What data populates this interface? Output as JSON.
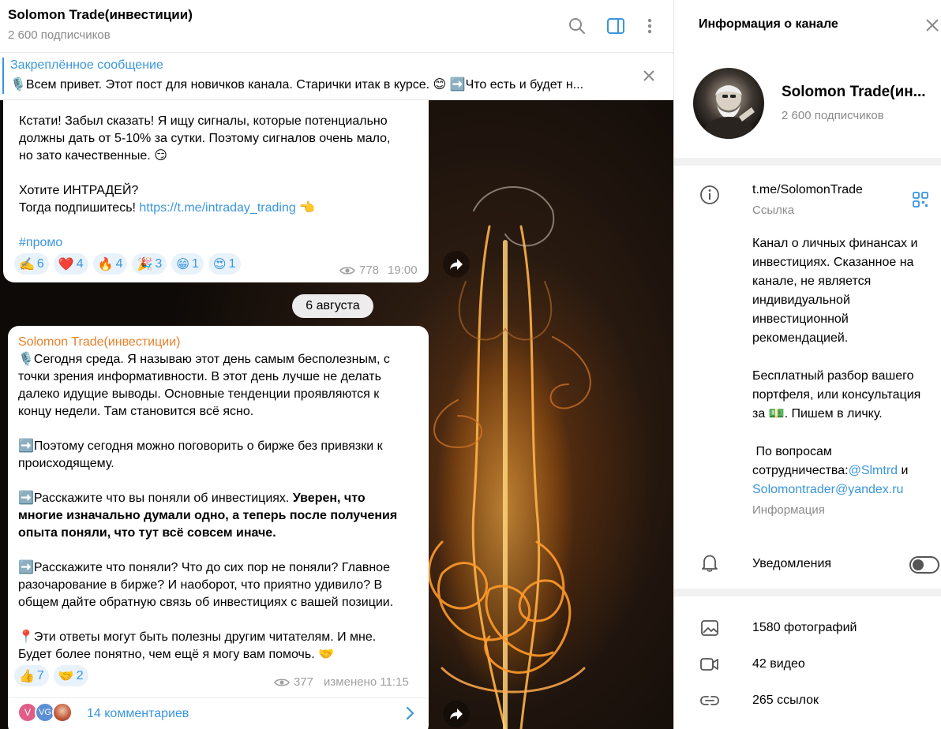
{
  "chat": {
    "title": "Solomon Trade(инвестиции)",
    "subscribers": "2 600 подписчиков",
    "pinned": {
      "title": "Закреплённое сообщение",
      "text": "🎙️Всем привет. Этот пост для новичков канала. Старички итак в курсе. 😊 ➡️Что есть и будет н..."
    },
    "message1": {
      "lines": [
        "Кстати! Забыл сказать! Я ищу сигналы, которые потенциально",
        "должны дать от 5-10% за сутки. Поэтому сигналов очень мало,",
        "но зато качественные. 😏",
        "",
        "Хотите ИНТРАДЕЙ?"
      ],
      "subscribe_prefix": "Тогда подпишитесь! ",
      "subscribe_link": "https://t.me/intraday_trading",
      "subscribe_suffix": " 👈",
      "hashtag": "#промо",
      "reactions": [
        {
          "emoji": "✍️",
          "count": "6"
        },
        {
          "emoji": "❤️",
          "count": "4"
        },
        {
          "emoji": "🔥",
          "count": "4"
        },
        {
          "emoji": "🎉",
          "count": "3"
        },
        {
          "emoji": "😁",
          "count": "1"
        },
        {
          "emoji": "😍",
          "count": "1"
        }
      ],
      "views": "778",
      "time": "19:00"
    },
    "date_separator": "6 августа",
    "message2": {
      "author": "Solomon Trade(инвестиции)",
      "p1": [
        "🎙️Сегодня среда. Я называю этот день самым бесполезным, с",
        "точки зрения информативности. В этот день лучше не делать",
        "далеко идущие выводы. Основные тенденции проявляются к",
        "концу недели. Там становится всё ясно."
      ],
      "p2": [
        "➡️Поэтому сегодня можно поговорить о бирже без привязки к",
        "происходящему."
      ],
      "p3_start": "➡️Расскажите что вы поняли об инвестициях. ",
      "p3_bold_1": "Уверен, что",
      "p3_bold_2": "многие изначально думали одно, а теперь после получения",
      "p3_bold_3": "опыта поняли, что тут всё совсем иначе.",
      "p4": [
        "➡️Расскажите что поняли? Что до сих пор не поняли? Главное",
        "разочарование в бирже? И наоборот, что приятно удивило? В",
        "общем дайте обратную связь об инвестициях с вашей позиции."
      ],
      "p5": [
        "📍Эти ответы могут быть полезны другим читателям. И мне.",
        "Будет более понятно, чем ещё я могу вам помочь. 🤝"
      ],
      "reactions": [
        {
          "emoji": "👍",
          "count": "7"
        },
        {
          "emoji": "🤝",
          "count": "2"
        }
      ],
      "views": "377",
      "edited": "изменено 11:15",
      "comment_avatars": [
        "V",
        "VG",
        ""
      ],
      "comments": "14 комментариев"
    }
  },
  "info": {
    "title": "Информация о канале",
    "name": "Solomon Trade(ин...",
    "subscribers": "2 600 подписчиков",
    "link": "t.me/SolomonTrade",
    "link_label": "Ссылка",
    "about_lines": [
      "Канал о личных финансах и",
      "инвестициях. Сказанное на",
      "канале, не является",
      "индивидуальной",
      "инвестиционной",
      "рекомендацией.",
      "",
      "Бесплатный разбор вашего",
      "портфеля, или консультация",
      "за 💵. Пишем в личку.",
      "",
      " По вопросам"
    ],
    "about_contact_prefix": "сотрудничества:",
    "about_contact_handle": "@Slmtrd",
    "about_contact_and": " и",
    "about_email": "Solomontrader@yandex.ru",
    "about_label": "Информация",
    "notifications": "Уведомления",
    "notifications_on": false,
    "media": [
      {
        "icon": "photo-icon",
        "label": "1580 фотографий"
      },
      {
        "icon": "video-icon",
        "label": "42 видео"
      },
      {
        "icon": "link-icon",
        "label": "265 ссылок"
      }
    ]
  },
  "colors": {
    "accent": "#3a96dd",
    "author": "#e8802a",
    "muted": "#8a8a8a"
  }
}
